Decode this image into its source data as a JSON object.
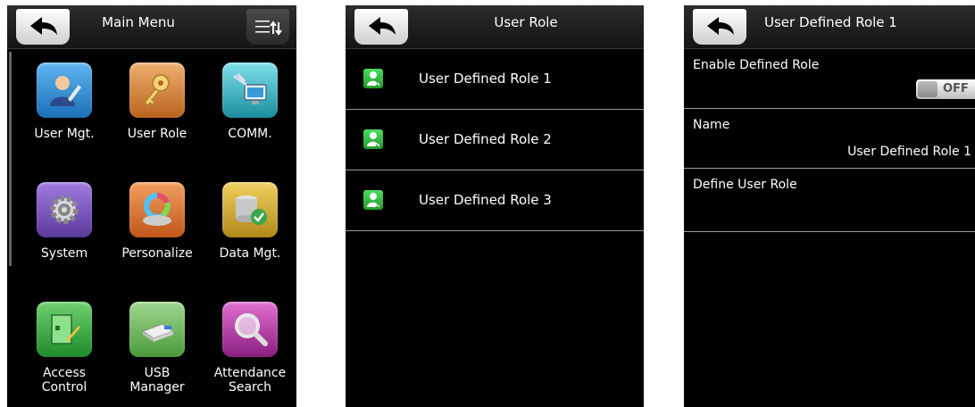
{
  "main_menu": {
    "title": "Main Menu",
    "items": [
      {
        "label": "User Mgt.",
        "icon": "user-mgt-icon",
        "color": "#2e8fd6"
      },
      {
        "label": "User Role",
        "icon": "key-icon",
        "color": "#d88a3a"
      },
      {
        "label": "COMM.",
        "icon": "comm-icon",
        "color": "#2aa8b8"
      },
      {
        "label": "System",
        "icon": "gear-icon",
        "color": "#7d52b8"
      },
      {
        "label": "Personalize",
        "icon": "personalize-icon",
        "color": "#e07a2a"
      },
      {
        "label": "Data Mgt.",
        "icon": "database-icon",
        "color": "#c9a531"
      },
      {
        "label": "Access\nControl",
        "icon": "access-control-icon",
        "color": "#3aaa3a"
      },
      {
        "label": "USB\nManager",
        "icon": "usb-icon",
        "color": "#6aa84f"
      },
      {
        "label": "Attendance\nSearch",
        "icon": "magnifier-icon",
        "color": "#c03aa8"
      }
    ]
  },
  "user_role": {
    "title": "User Role",
    "items": [
      {
        "label": "User Defined Role 1",
        "icon": "role-1-icon"
      },
      {
        "label": "User Defined Role 2",
        "icon": "role-2-icon"
      },
      {
        "label": "User Defined Role 3",
        "icon": "role-3-icon"
      }
    ]
  },
  "role_detail": {
    "title": "User Defined Role 1",
    "enable_label": "Enable Defined Role",
    "enable_state": "OFF",
    "name_label": "Name",
    "name_value": "User Defined Role 1",
    "define_label": "Define User Role"
  },
  "colors": {
    "screen_bg": "#000000",
    "title_text": "#ffffff",
    "divider": "#9a9a9a",
    "role_icon_green": "#2fbf3f"
  }
}
